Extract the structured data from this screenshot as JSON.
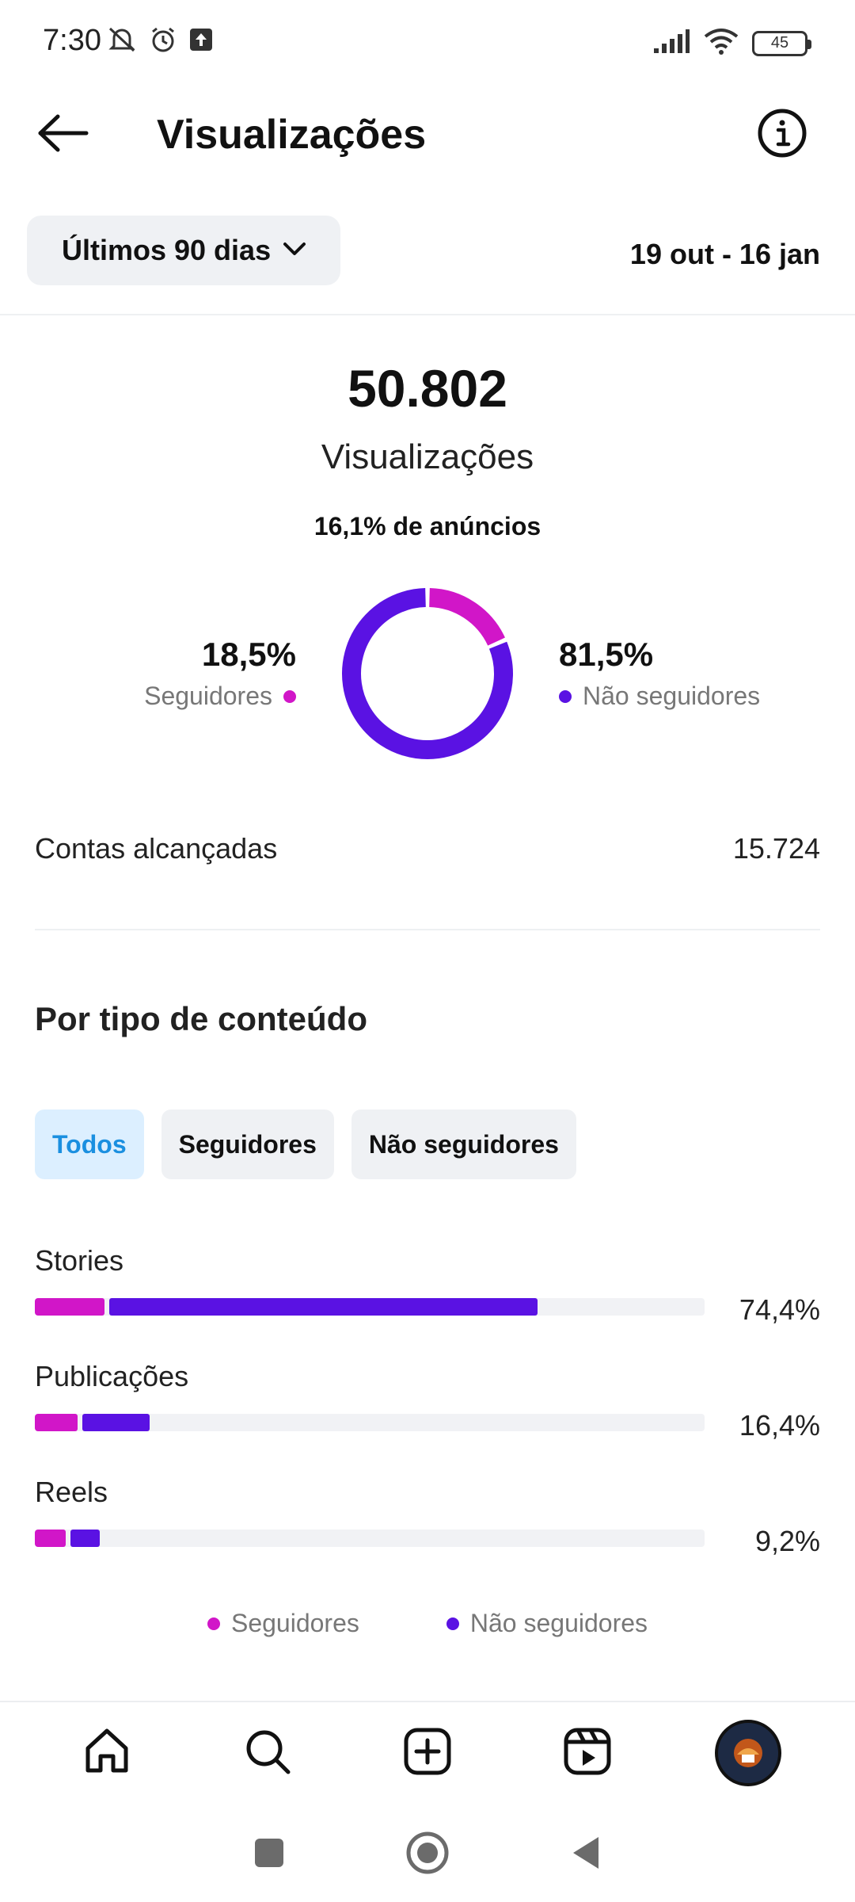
{
  "status_bar": {
    "time": "7:30",
    "battery": "45"
  },
  "header": {
    "title": "Visualizações"
  },
  "period": {
    "selected": "Últimos 90 dias",
    "date_range": "19 out - 16 jan"
  },
  "summary": {
    "total": "50.802",
    "label": "Visualizações",
    "ads_share": "16,1% de anúncios",
    "followers_pct": "18,5%",
    "followers_label": "Seguidores",
    "non_followers_pct": "81,5%",
    "non_followers_label": "Não seguidores"
  },
  "reached": {
    "label": "Contas alcançadas",
    "value": "15.724"
  },
  "content_type": {
    "title": "Por tipo de conteúdo",
    "filters": [
      "Todos",
      "Seguidores",
      "Não seguidores"
    ],
    "rows": [
      {
        "label": "Stories",
        "value": "74,4%",
        "followers_share": 0.104,
        "non_followers_share": 0.64
      },
      {
        "label": "Publicações",
        "value": "16,4%",
        "followers_share": 0.064,
        "non_followers_share": 0.1
      },
      {
        "label": "Reels",
        "value": "9,2%",
        "followers_share": 0.046,
        "non_followers_share": 0.044
      }
    ],
    "legend": [
      "Seguidores",
      "Não seguidores"
    ]
  },
  "colors": {
    "followers": "#d116c8",
    "non_followers": "#5a12e3",
    "active_chip_text": "#1a8fe0"
  },
  "chart_data": {
    "type": "pie",
    "categories": [
      "Seguidores",
      "Não seguidores"
    ],
    "values": [
      18.5,
      81.5
    ]
  }
}
